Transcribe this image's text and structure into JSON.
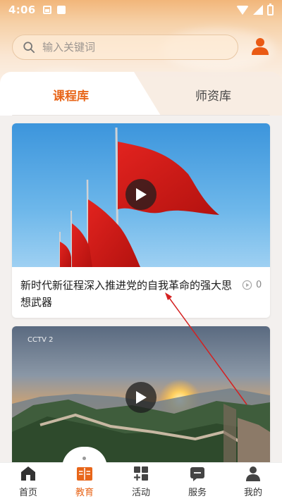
{
  "status_bar": {
    "time": "4:06"
  },
  "search": {
    "placeholder": "输入关键词"
  },
  "tabs": [
    {
      "label": "课程库",
      "active": true
    },
    {
      "label": "师资库",
      "active": false
    }
  ],
  "courses": [
    {
      "title": "新时代新征程深入推进党的自我革命的强大思想武器",
      "views": "0",
      "thumbnail": "red-flags"
    },
    {
      "title": "",
      "thumbnail": "great-wall-sunset",
      "channel_logo": "CCTV 2"
    }
  ],
  "bottom_nav": [
    {
      "label": "首页",
      "icon": "home-icon",
      "active": false
    },
    {
      "label": "教育",
      "icon": "book-icon",
      "active": true
    },
    {
      "label": "活动",
      "icon": "grid-plus-icon",
      "active": false
    },
    {
      "label": "服务",
      "icon": "message-icon",
      "active": false
    },
    {
      "label": "我的",
      "icon": "person-icon",
      "active": false
    }
  ],
  "colors": {
    "accent": "#e8661a",
    "flag_red": "#d81e1e",
    "sky_blue": "#4fa3e0"
  }
}
